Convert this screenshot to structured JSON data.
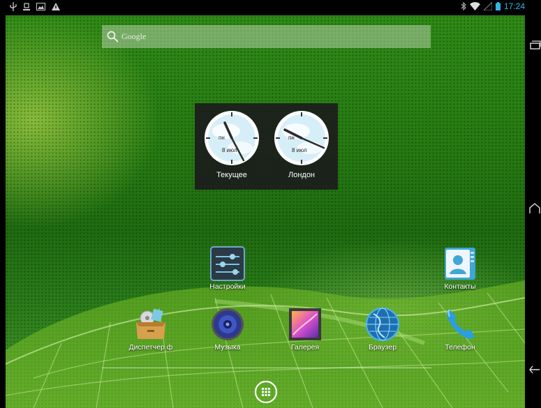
{
  "status_bar": {
    "left_icons": [
      "usb-icon",
      "storage-icon",
      "gallery-notification-icon",
      "warning-icon"
    ],
    "right_icons": [
      "bluetooth-icon",
      "wifi-icon",
      "cell-signal-icon",
      "battery-icon"
    ],
    "time": "17:24"
  },
  "search": {
    "placeholder": "Google"
  },
  "clock_widget": {
    "clocks": [
      {
        "label": "Текущее",
        "day": "пн",
        "date": "8 июл"
      },
      {
        "label": "Лондон",
        "day": "пн",
        "date": "8 июл"
      }
    ]
  },
  "apps": {
    "settings": "Настройки",
    "contacts": "Контакты",
    "file_manager": "Диспетчер ф",
    "music": "Музыка",
    "gallery": "Галерея",
    "browser": "Браузер",
    "phone": "Телефон"
  },
  "nav_bar": {
    "buttons": [
      "recent-apps-icon",
      "home-icon",
      "back-icon"
    ]
  },
  "colors": {
    "clock_accent": "#33b5e5",
    "wallpaper_green": "#257a12"
  }
}
